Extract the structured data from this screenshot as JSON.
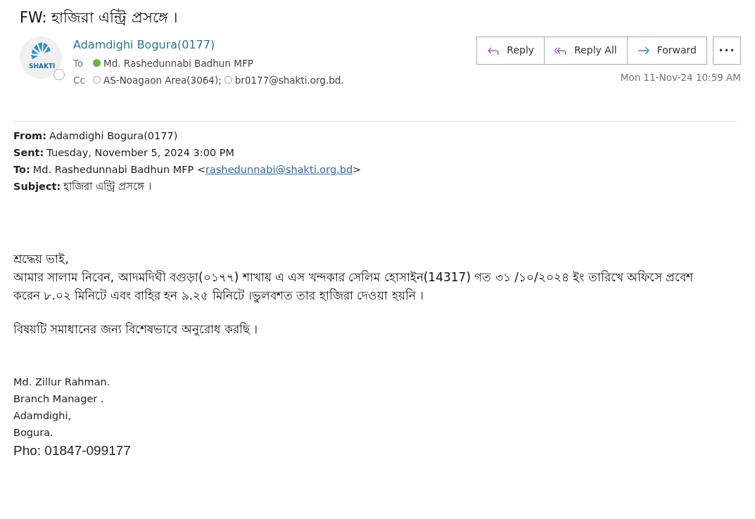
{
  "subject": "FW:  হাজিরা এন্ট্রি প্রসঙ্গে ।",
  "sender": {
    "avatar_text": "SHAKTI",
    "available": false,
    "name": "Adamdighi Bogura(0177)"
  },
  "recipients": [
    {
      "label": "To",
      "people": [
        {
          "name": "Md. Rashedunnabi Badhun MFP",
          "available": true
        }
      ]
    },
    {
      "label": "Cc",
      "people": [
        {
          "name": "AS-Noagaon Area(3064);",
          "available": false
        },
        {
          "name": "br0177@shakti.org.bd.",
          "available": false
        }
      ]
    }
  ],
  "actions": [
    {
      "label": "Reply",
      "kind": "reply"
    },
    {
      "label": "Reply All",
      "kind": "reply-all"
    },
    {
      "label": "Forward",
      "kind": "forward"
    }
  ],
  "more_button": "•••",
  "received": "Mon 11-Nov-24 10:59 AM",
  "forward_header": [
    {
      "label": "From:",
      "value": "Adamdighi Bogura(0177)"
    },
    {
      "label": "Sent:",
      "value": "Tuesday, November 5, 2024 3:00 PM"
    },
    {
      "label": "To:",
      "value": "Md. Rashedunnabi Badhun MFP <",
      "link": "rashedunnabi@shakti.org.bd",
      "after": ">"
    },
    {
      "label": "Subject:",
      "value": "হাজিরা  এন্ট্রি  প্রসঙ্গে  ।"
    }
  ],
  "body": [
    "শ্রদ্ধেয় ভাই,",
    "আমার সালাম নিবেন, আদমদিঘী বগুড়া(০১৭৭) শাখায় এ এস খন্দকার সেলিম হোসাইন(14317) গত ৩১ /১০/২০২৪ ইং তারিখে অফিসে প্রবেশ করেন ৮.০২ মিনিটে এবং বাহির হন ৯.২৫ মিনিটে ।ভুলবশত তার হাজিরা দেওয়া হয়নি ।",
    "বিষয়টি সমাধানের জন্য বিশেষভাবে অনুরোধ করছি ।"
  ],
  "signature": [
    "Md. Zillur Rahman.",
    "Branch Manager .",
    "Adamdighi,",
    "Bogura."
  ],
  "phone": "Pho: 01847-099177"
}
